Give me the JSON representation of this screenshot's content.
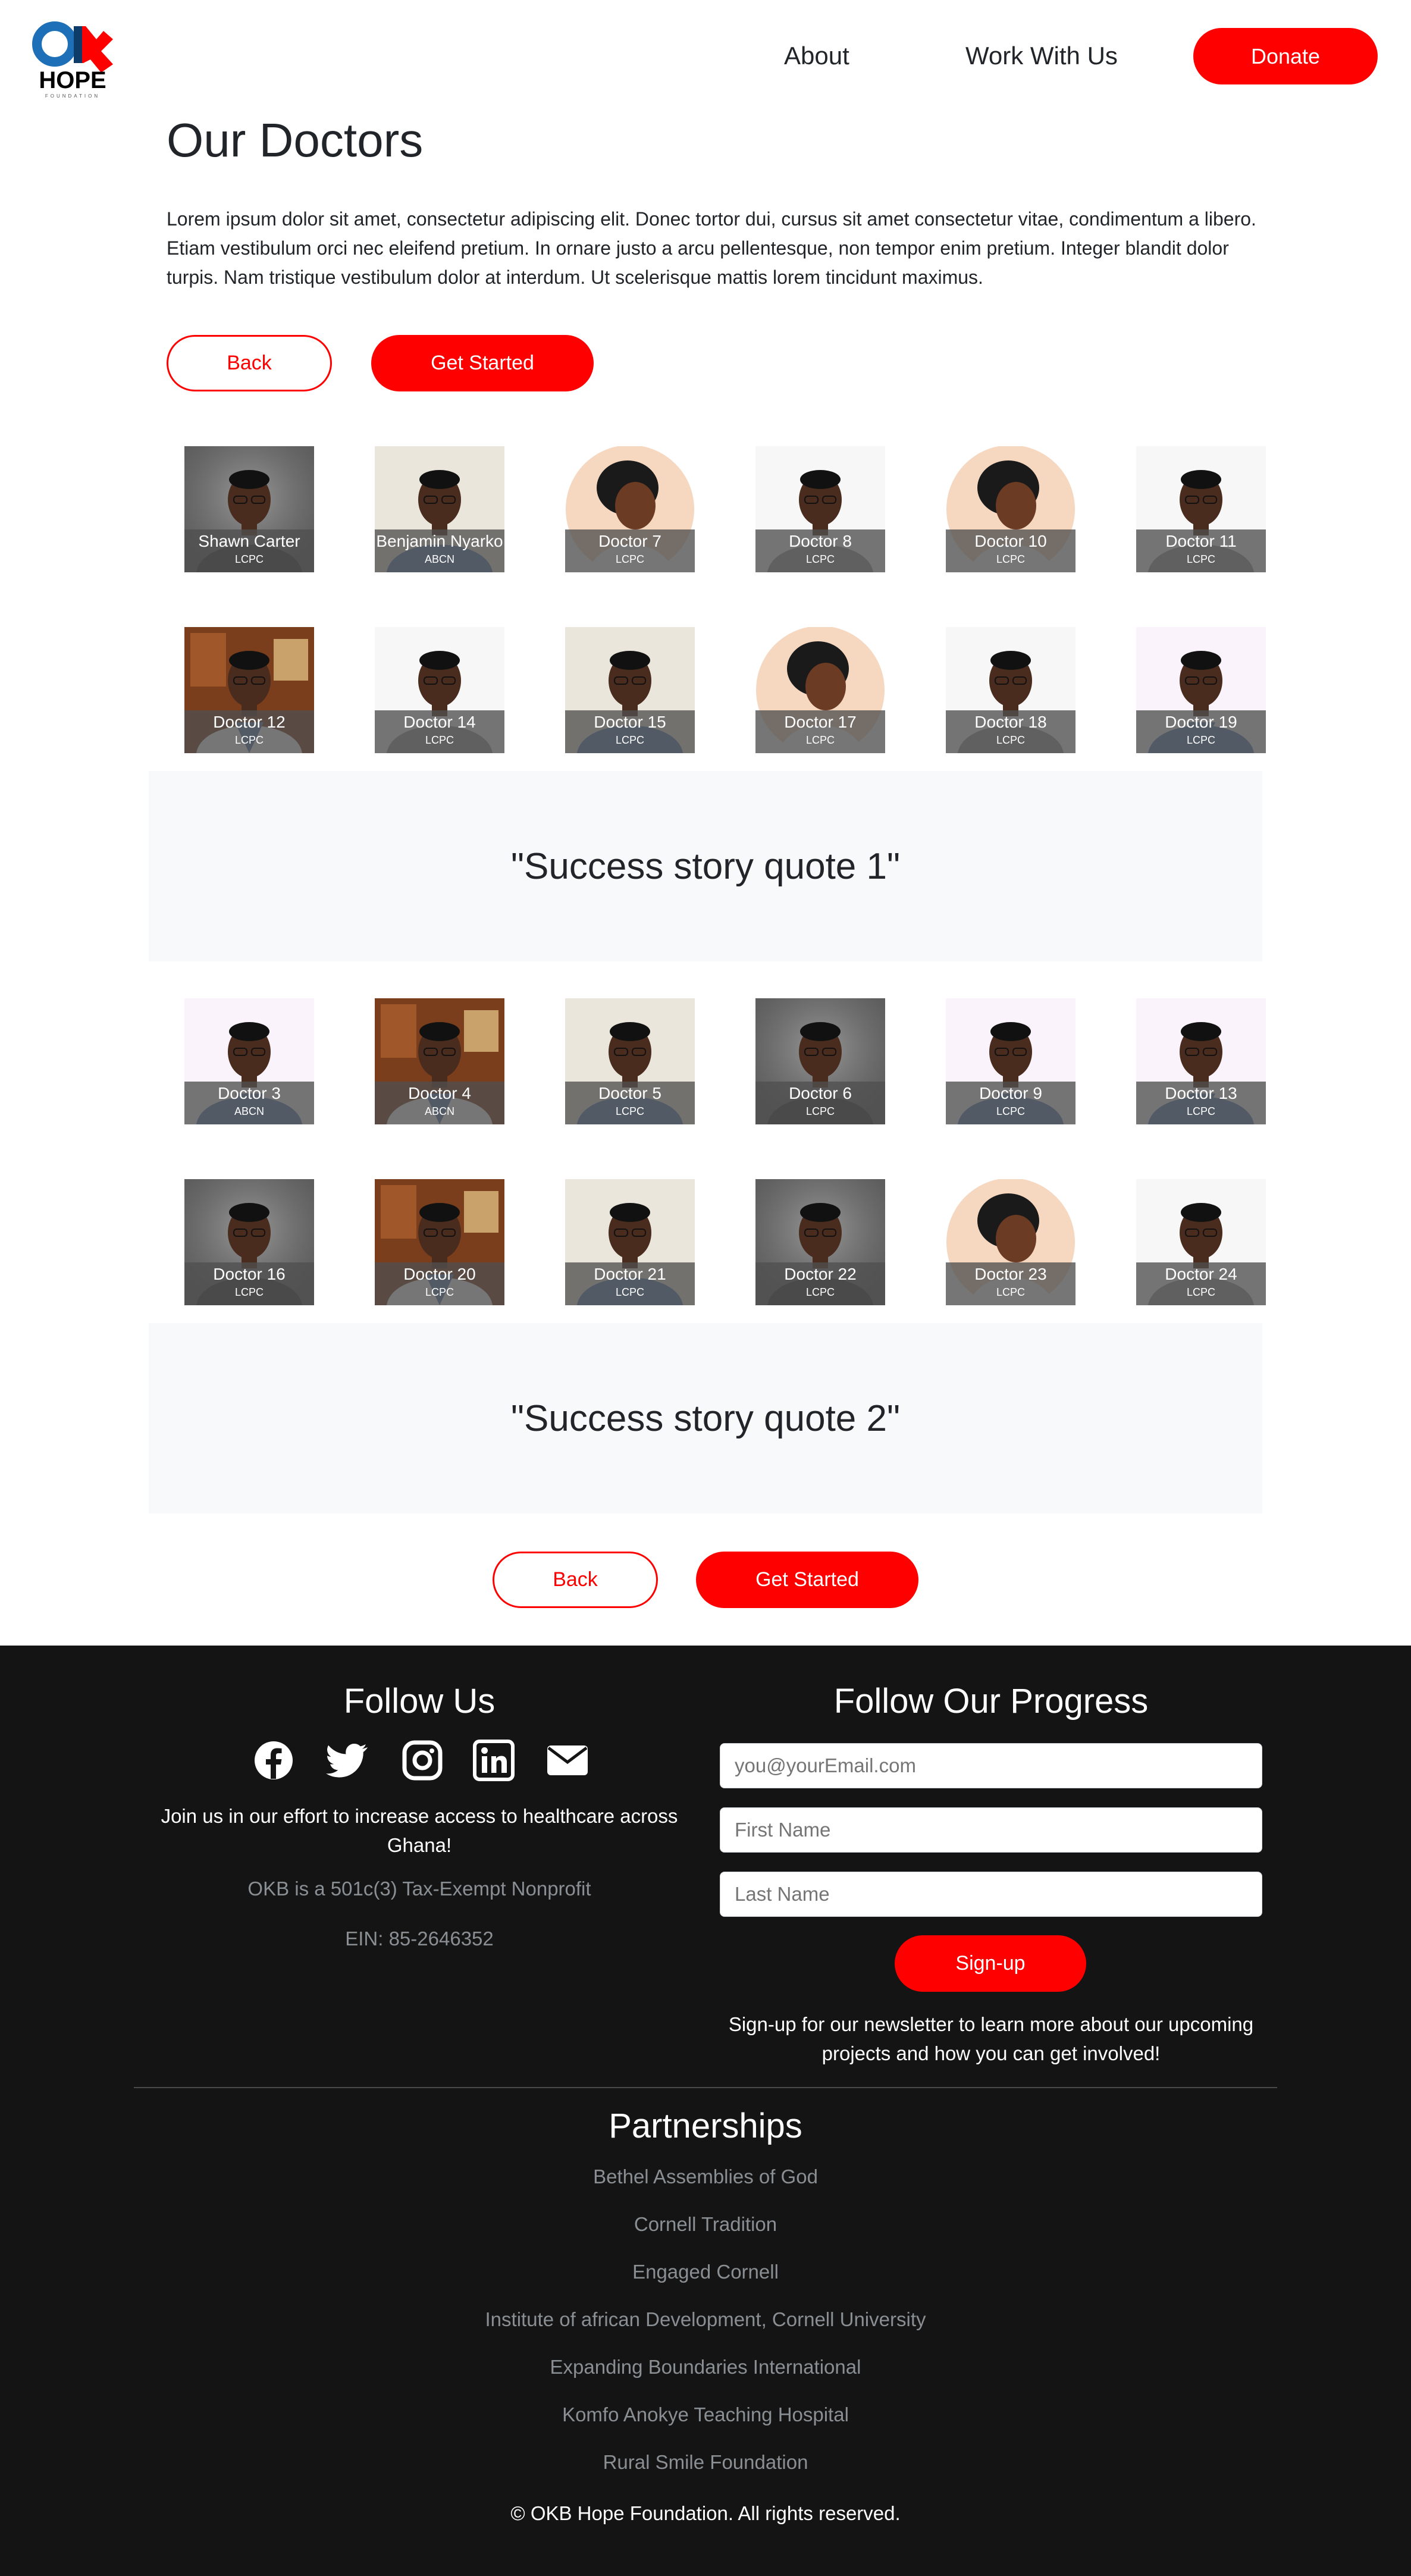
{
  "header": {
    "logo_text": "HOPE",
    "logo_mark": "OKB",
    "logo_sub": "FOUNDATION",
    "nav": [
      {
        "label": "About"
      },
      {
        "label": "Work With Us"
      }
    ],
    "donate_label": "Donate"
  },
  "main": {
    "title": "Our Doctors",
    "intro": "Lorem ipsum dolor sit amet, consectetur adipiscing elit. Donec tortor dui, cursus sit amet consectetur vitae, condimentum a libero. Etiam vestibulum orci nec eleifend pretium. In ornare justo a arcu pellentesque, non tempor enim pretium. Integer blandit dolor turpis. Nam tristique vestibulum dolor at interdum. Ut scelerisque mattis lorem tincidunt maximus.",
    "back_label": "Back",
    "get_started_label": "Get Started"
  },
  "doctor_rows": [
    [
      {
        "name": "Shawn Carter",
        "cred": "LCPC",
        "photo": "grey"
      },
      {
        "name": "Benjamin Nyarko",
        "cred": "ABCN",
        "photo": "cream"
      },
      {
        "name": "Doctor 7",
        "cred": "LCPC",
        "photo": "circle"
      },
      {
        "name": "Doctor 8",
        "cred": "LCPC",
        "photo": "white"
      },
      {
        "name": "Doctor 10",
        "cred": "LCPC",
        "photo": "circle"
      },
      {
        "name": "Doctor 11",
        "cred": "LCPC",
        "photo": "white"
      }
    ],
    [
      {
        "name": "Doctor 12",
        "cred": "LCPC",
        "photo": "office"
      },
      {
        "name": "Doctor 14",
        "cred": "LCPC",
        "photo": "white"
      },
      {
        "name": "Doctor 15",
        "cred": "LCPC",
        "photo": "cream"
      },
      {
        "name": "Doctor 17",
        "cred": "LCPC",
        "photo": "circle"
      },
      {
        "name": "Doctor 18",
        "cred": "LCPC",
        "photo": "white"
      },
      {
        "name": "Doctor 19",
        "cred": "LCPC",
        "photo": "pink"
      }
    ],
    [
      {
        "name": "Doctor 3",
        "cred": "ABCN",
        "photo": "pink"
      },
      {
        "name": "Doctor 4",
        "cred": "ABCN",
        "photo": "office"
      },
      {
        "name": "Doctor 5",
        "cred": "LCPC",
        "photo": "cream"
      },
      {
        "name": "Doctor 6",
        "cred": "LCPC",
        "photo": "grey"
      },
      {
        "name": "Doctor 9",
        "cred": "LCPC",
        "photo": "pink"
      },
      {
        "name": "Doctor 13",
        "cred": "LCPC",
        "photo": "pink"
      }
    ],
    [
      {
        "name": "Doctor 16",
        "cred": "LCPC",
        "photo": "grey"
      },
      {
        "name": "Doctor 20",
        "cred": "LCPC",
        "photo": "office"
      },
      {
        "name": "Doctor 21",
        "cred": "LCPC",
        "photo": "cream"
      },
      {
        "name": "Doctor 22",
        "cred": "LCPC",
        "photo": "grey"
      },
      {
        "name": "Doctor 23",
        "cred": "LCPC",
        "photo": "circle"
      },
      {
        "name": "Doctor 24",
        "cred": "LCPC",
        "photo": "white"
      }
    ]
  ],
  "quotes": [
    "\"Success story quote 1\"",
    "\"Success story quote 2\""
  ],
  "footer": {
    "follow_title": "Follow Us",
    "social_icons": [
      "facebook-icon",
      "twitter-icon",
      "instagram-icon",
      "linkedin-icon",
      "envelope-icon"
    ],
    "join_text": "Join us in our effort to increase access to healthcare across Ghana!",
    "nonprofit_text": "OKB is a 501c(3) Tax-Exempt Nonprofit",
    "ein_text": "EIN: 85-2646352",
    "progress_title": "Follow Our Progress",
    "email_placeholder": "you@yourEmail.com",
    "first_name_placeholder": "First Name",
    "last_name_placeholder": "Last Name",
    "signup_label": "Sign-up",
    "newsletter_text": "Sign-up for our newsletter to learn more about our upcoming projects and how you can get involved!",
    "partnerships_title": "Partnerships",
    "partners": [
      "Bethel Assemblies of God",
      "Cornell Tradition",
      "Engaged Cornell",
      "Institute of african Development, Cornell University",
      "Expanding Boundaries International",
      "Komfo Anokye Teaching Hospital",
      "Rural Smile Foundation"
    ],
    "copyright": "© OKB Hope Foundation. All rights reserved."
  },
  "colors": {
    "brand_red": "#ff0000",
    "brand_blue": "#1d6fb8",
    "footer_bg": "#141414"
  }
}
